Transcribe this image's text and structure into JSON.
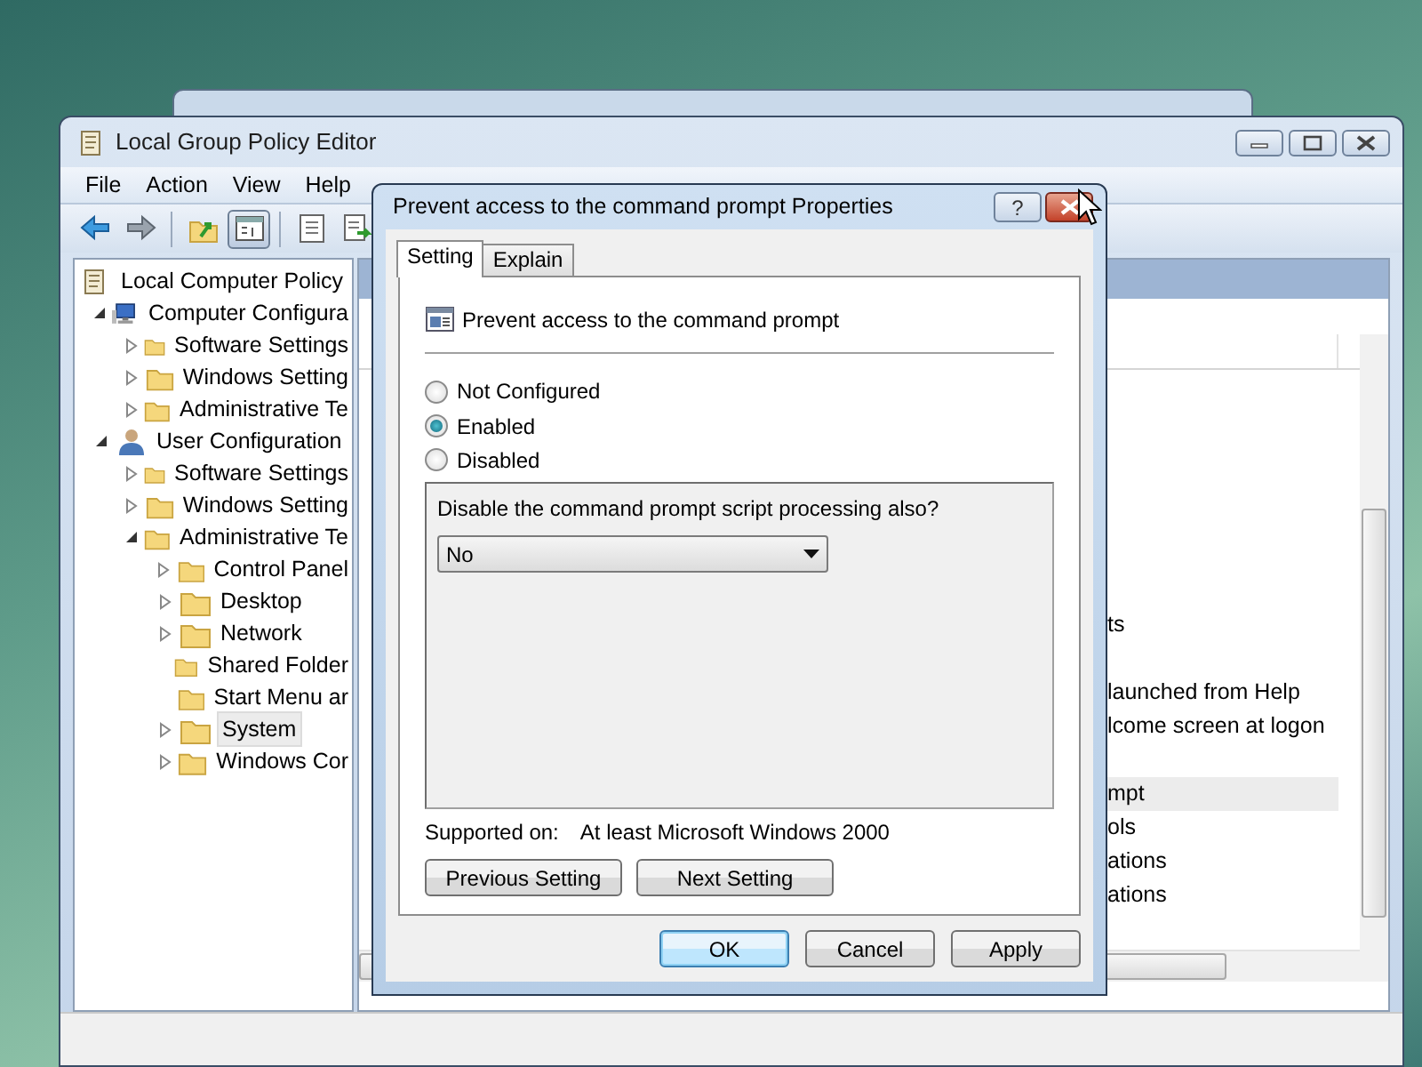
{
  "window": {
    "title": "Local Group Policy Editor"
  },
  "menu": [
    "File",
    "Action",
    "View",
    "Help"
  ],
  "toolbar": [
    {
      "kind": "back",
      "pressed": false
    },
    {
      "kind": "forward",
      "pressed": false
    },
    {
      "kind": "up",
      "pressed": false
    },
    {
      "kind": "tree",
      "pressed": true
    },
    {
      "kind": "properties",
      "pressed": false
    },
    {
      "kind": "export",
      "pressed": false
    }
  ],
  "tree": [
    {
      "label": "Local Computer Policy",
      "kind": "policy",
      "selected": false,
      "children": [
        {
          "label": "Computer Configura",
          "kind": "computer",
          "expanded": true,
          "selected": false,
          "children": [
            {
              "label": "Software Settings",
              "kind": "folder",
              "expanded": false,
              "selected": false
            },
            {
              "label": "Windows Setting",
              "kind": "folder",
              "expanded": false,
              "selected": false
            },
            {
              "label": "Administrative Te",
              "kind": "folder",
              "expanded": false,
              "selected": false
            }
          ]
        },
        {
          "label": "User Configuration",
          "kind": "user",
          "expanded": true,
          "selected": false,
          "children": [
            {
              "label": "Software Settings",
              "kind": "folder",
              "expanded": false,
              "selected": false
            },
            {
              "label": "Windows Setting",
              "kind": "folder",
              "expanded": false,
              "selected": false
            },
            {
              "label": "Administrative Te",
              "kind": "folder",
              "expanded": true,
              "selected": false,
              "children": [
                {
                  "label": "Control Panel",
                  "kind": "folder",
                  "expanded": false,
                  "selected": false
                },
                {
                  "label": "Desktop",
                  "kind": "folder",
                  "expanded": false,
                  "selected": false
                },
                {
                  "label": "Network",
                  "kind": "folder",
                  "expanded": false,
                  "selected": false
                },
                {
                  "label": "Shared Folder",
                  "kind": "folder",
                  "selected": false
                },
                {
                  "label": "Start Menu ar",
                  "kind": "folder",
                  "selected": false
                },
                {
                  "label": "System",
                  "kind": "folder",
                  "expanded": false,
                  "selected": true
                },
                {
                  "label": "Windows Cor",
                  "kind": "folder",
                  "expanded": false,
                  "selected": false
                }
              ]
            }
          ]
        }
      ]
    }
  ],
  "details": {
    "rows": [
      {
        "text": "ts",
        "selected": false
      },
      {
        "text": "launched from Help",
        "selected": false
      },
      {
        "text": "lcome screen at logon",
        "selected": false
      },
      {
        "text": "mpt",
        "selected": true
      },
      {
        "text": "ols",
        "selected": false
      },
      {
        "text": "ations",
        "selected": false
      },
      {
        "text": "ations",
        "selected": false
      }
    ]
  },
  "dialog": {
    "title": "Prevent access to the command prompt Properties",
    "help_button": "?",
    "tabs": [
      {
        "label": "Setting",
        "selected": true
      },
      {
        "label": "Explain",
        "selected": false
      }
    ],
    "policy_name": "Prevent access to the command prompt",
    "options": [
      {
        "label": "Not Configured",
        "selected": false
      },
      {
        "label": "Enabled",
        "selected": true
      },
      {
        "label": "Disabled",
        "selected": false
      }
    ],
    "option_question": "Disable the command prompt script processing also?",
    "option_value": "No",
    "supported_label": "Supported on:",
    "supported_value": "At least Microsoft Windows 2000",
    "nav_buttons": [
      "Previous Setting",
      "Next Setting"
    ],
    "buttons": [
      {
        "label": "OK",
        "default": true
      },
      {
        "label": "Cancel",
        "default": false
      },
      {
        "label": "Apply",
        "default": false
      }
    ]
  }
}
